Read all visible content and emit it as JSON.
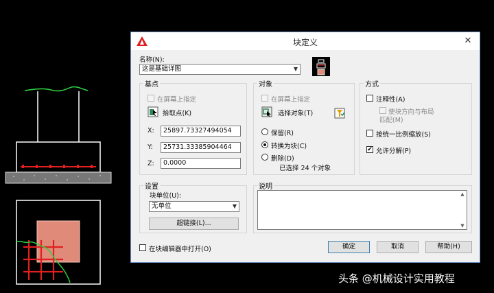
{
  "dialog": {
    "title": "块定义",
    "close_label": "✕",
    "name_label": "名称(N):",
    "name_value": "这是基础详图"
  },
  "base_point": {
    "group_label": "基点",
    "specify_on_screen": "在屏幕上指定",
    "pick_point_label": "拾取点(K)",
    "x_label": "X:",
    "x_value": "25897.73327494054",
    "y_label": "Y:",
    "y_value": "25731.33385904464",
    "z_label": "Z:",
    "z_value": "0.0000"
  },
  "objects": {
    "group_label": "对象",
    "specify_on_screen": "在屏幕上指定",
    "select_objects_label": "选择对象(T)",
    "retain_label": "保留(R)",
    "convert_label": "转换为块(C)",
    "delete_label": "删除(D)",
    "selected_count": "已选择 24 个对象"
  },
  "behavior": {
    "group_label": "方式",
    "annotative_label": "注释性(A)",
    "match_orientation_line1": "使块方向与布局",
    "match_orientation_line2": "匹配(M)",
    "scale_uniformly_label": "按统一比例缩放(S)",
    "allow_exploding_label": "允许分解(P)",
    "allow_exploding_checked": "✔"
  },
  "settings": {
    "group_label": "设置",
    "unit_label": "块单位(U):",
    "unit_value": "无单位",
    "hyperlink_label": "超链接(L)..."
  },
  "description": {
    "group_label": "说明"
  },
  "footer": {
    "open_in_editor_label": "在块编辑器中打开(O)",
    "ok_label": "确定",
    "cancel_label": "取消",
    "help_label": "帮助(H)"
  },
  "watermark": "头条 @机械设计实用教程",
  "colors": {
    "accent_red": "#e02020",
    "green_line": "#2ecc40",
    "fill_salmon": "#e08a7a",
    "dialog_bg": "#f0f0f0"
  }
}
